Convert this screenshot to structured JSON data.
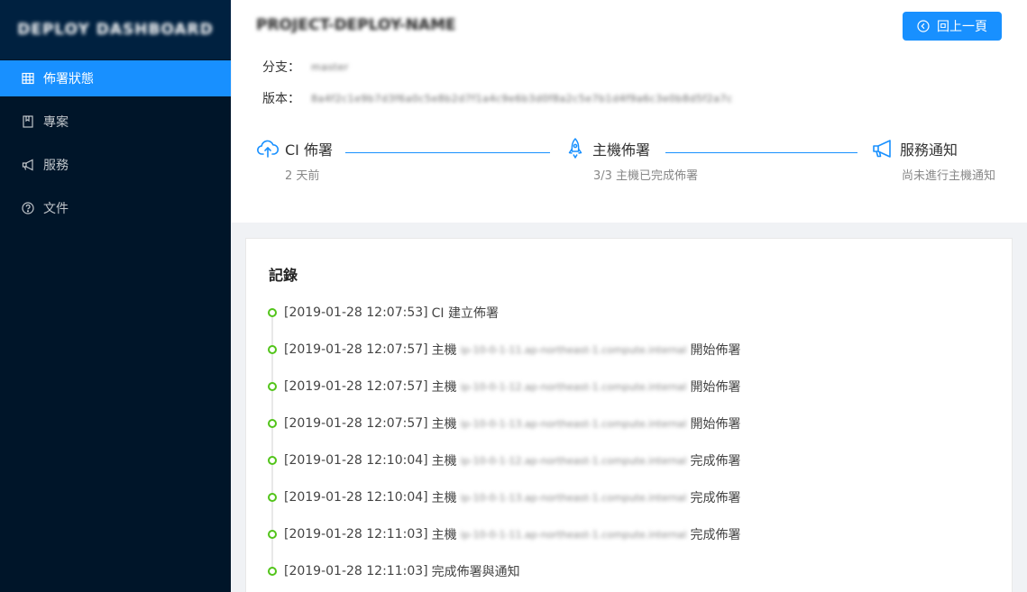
{
  "sidebar": {
    "logo": "DEPLOY DASHBOARD",
    "items": [
      {
        "label": "佈署狀態",
        "icon": "table-icon",
        "active": true
      },
      {
        "label": "專案",
        "icon": "book-icon",
        "active": false
      },
      {
        "label": "服務",
        "icon": "megaphone-icon",
        "active": false
      },
      {
        "label": "文件",
        "icon": "question-circle-icon",
        "active": false
      }
    ]
  },
  "header": {
    "title": "PROJECT-DEPLOY-NAME",
    "back_label": "回上一頁",
    "branch_label": "分支：",
    "branch_value": "master",
    "version_label": "版本：",
    "version_value": "8a4f2c1e9b7d3f6a0c5e8b2d7f1a4c9e6b3d0f8a2c5e7b1d4f9a6c3e0b8d5f2a7c"
  },
  "steps": [
    {
      "title": "CI 佈署",
      "desc": "2 天前",
      "icon": "cloud-upload-icon"
    },
    {
      "title": "主機佈署",
      "desc": "3/3 主機已完成佈署",
      "icon": "rocket-icon"
    },
    {
      "title": "服務通知",
      "desc": "尚未進行主機通知",
      "icon": "notification-icon"
    }
  ],
  "log": {
    "title": "記錄",
    "entries": [
      {
        "time": "[2019-01-28 12:07:53]",
        "prefix": "CI 建立佈署",
        "host": "",
        "suffix": ""
      },
      {
        "time": "[2019-01-28 12:07:57]",
        "prefix": "主機",
        "host": "ip-10-0-1-11.ap-northeast-1.compute.internal",
        "suffix": "開始佈署"
      },
      {
        "time": "[2019-01-28 12:07:57]",
        "prefix": "主機",
        "host": "ip-10-0-1-12.ap-northeast-1.compute.internal",
        "suffix": "開始佈署"
      },
      {
        "time": "[2019-01-28 12:07:57]",
        "prefix": "主機",
        "host": "ip-10-0-1-13.ap-northeast-1.compute.internal",
        "suffix": "開始佈署"
      },
      {
        "time": "[2019-01-28 12:10:04]",
        "prefix": "主機",
        "host": "ip-10-0-1-12.ap-northeast-1.compute.internal",
        "suffix": "完成佈署"
      },
      {
        "time": "[2019-01-28 12:10:04]",
        "prefix": "主機",
        "host": "ip-10-0-1-13.ap-northeast-1.compute.internal",
        "suffix": "完成佈署"
      },
      {
        "time": "[2019-01-28 12:11:03]",
        "prefix": "主機",
        "host": "ip-10-0-1-11.ap-northeast-1.compute.internal",
        "suffix": "完成佈署"
      },
      {
        "time": "[2019-01-28 12:11:03]",
        "prefix": "完成佈署與通知",
        "host": "",
        "suffix": ""
      }
    ]
  },
  "colors": {
    "primary": "#1890ff",
    "sidebar": "#001529",
    "success": "#52c41a"
  }
}
